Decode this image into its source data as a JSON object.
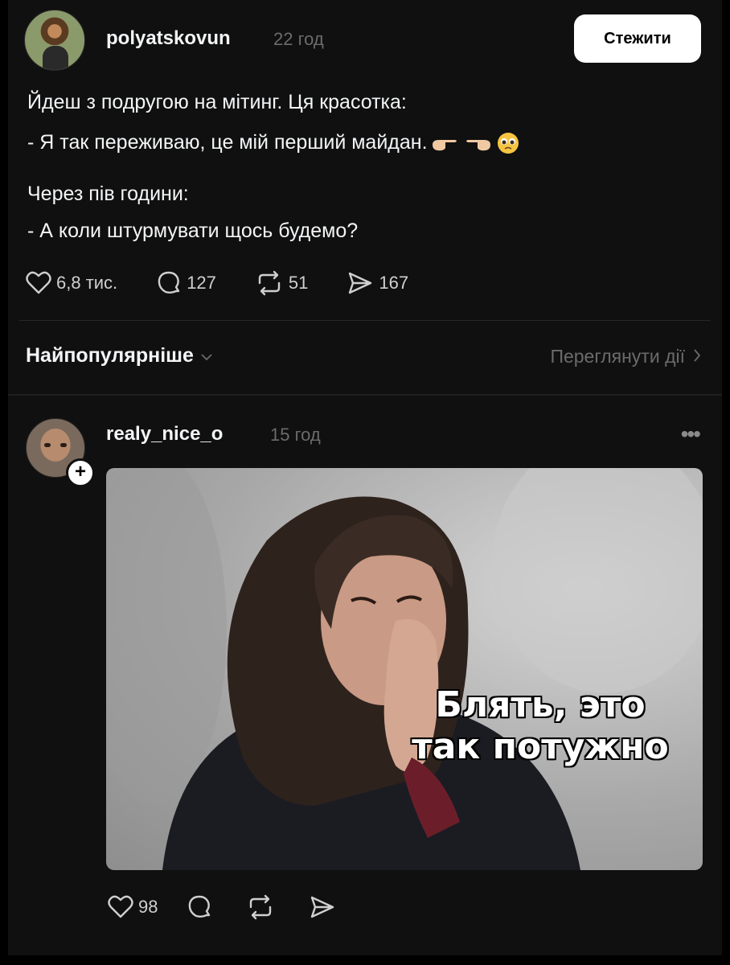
{
  "post": {
    "username": "polyatskovun",
    "time": "22 год",
    "follow_label": "Стежити",
    "lines": [
      "Йдеш з подругою на мітинг. Ця красотка:",
      "- Я так переживаю, це мій перший майдан.",
      "Через пів години:",
      "- А коли штурмувати щось будемо?"
    ],
    "emoji_icons": [
      "point-right-emoji",
      "point-left-emoji",
      "pleading-face-emoji"
    ],
    "likes": "6,8 тис.",
    "comments": "127",
    "reposts": "51",
    "shares": "167"
  },
  "sort": {
    "label": "Найпопулярніше",
    "view_activity": "Переглянути дії"
  },
  "reply": {
    "username": "realy_nice_o",
    "time": "15 год",
    "add_label": "+",
    "more_label": "•••",
    "meme_caption_line1": "Блять, это",
    "meme_caption_line2": "так потужно",
    "likes": "98"
  },
  "colors": {
    "background": "#101010",
    "text": "#f3f5f7",
    "muted": "#6b6b6b",
    "button_bg": "#ffffff"
  }
}
